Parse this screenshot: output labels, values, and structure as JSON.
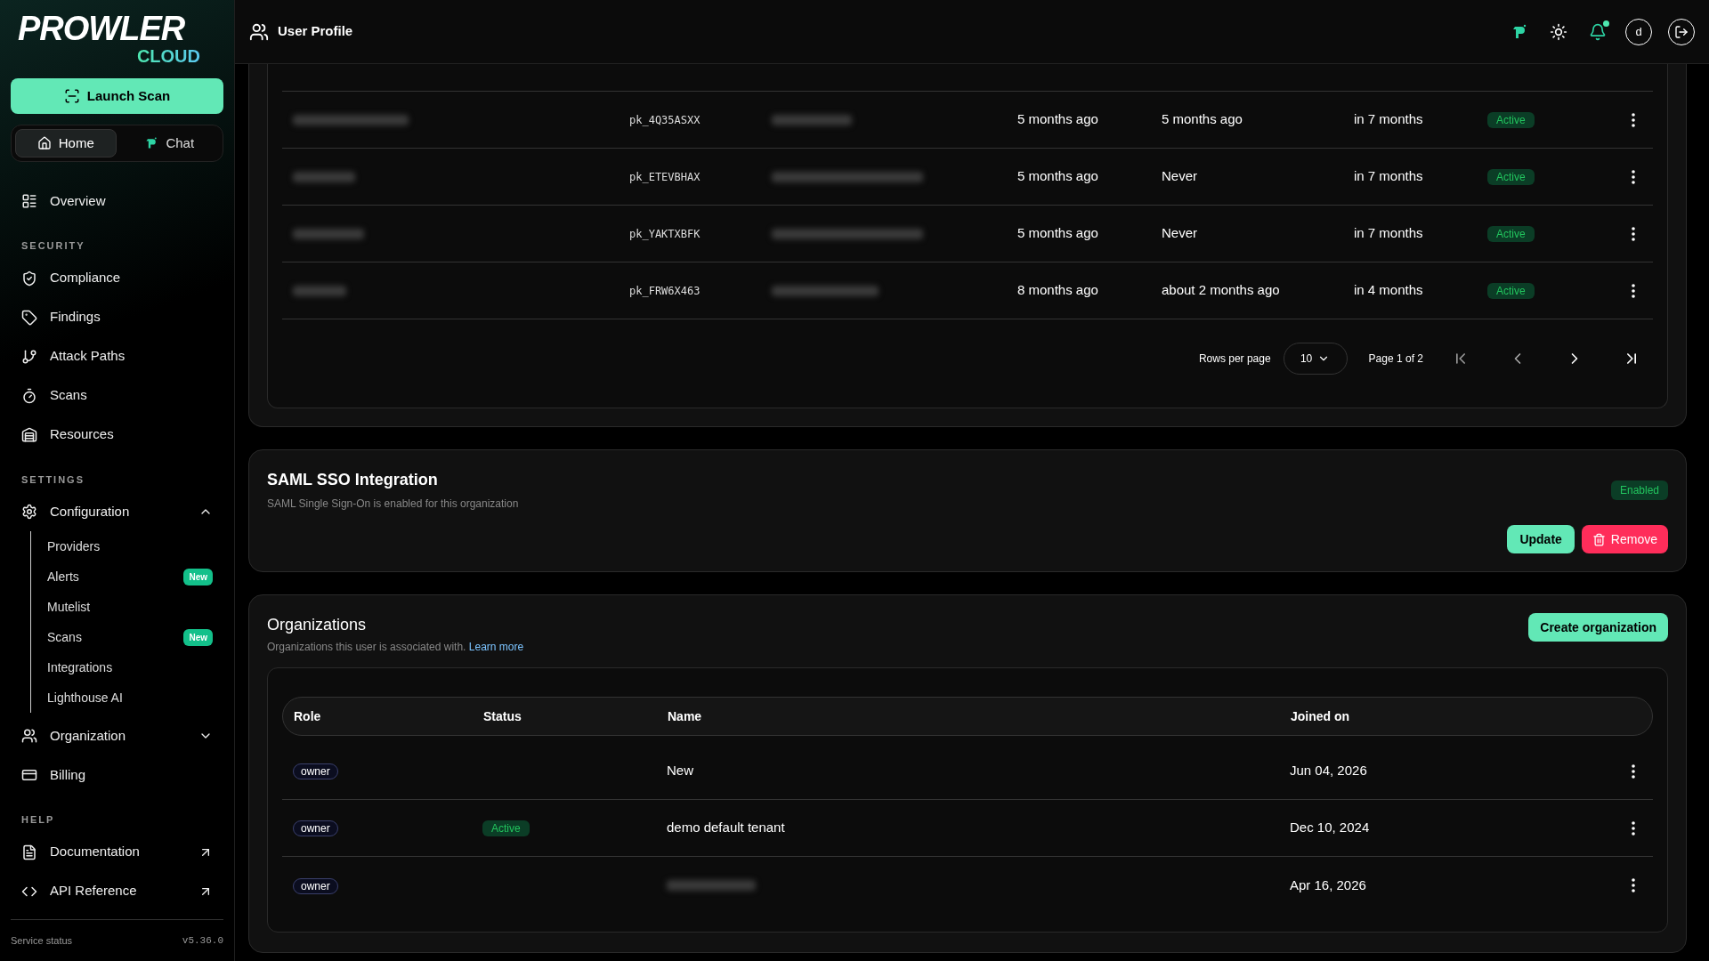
{
  "sidebar": {
    "logo": {
      "word": "PROWLER",
      "sub": "CLOUD"
    },
    "launch_button": "Launch Scan",
    "tabs": [
      {
        "label": "Home",
        "selected": true
      },
      {
        "label": "Chat",
        "selected": false
      }
    ],
    "sections": [
      {
        "items": [
          {
            "label": "Overview"
          }
        ]
      },
      {
        "heading": "SECURITY",
        "items": [
          {
            "label": "Compliance"
          },
          {
            "label": "Findings"
          },
          {
            "label": "Attack Paths"
          },
          {
            "label": "Scans"
          },
          {
            "label": "Resources"
          }
        ]
      },
      {
        "heading": "SETTINGS",
        "items": [
          {
            "label": "Configuration",
            "expanded": true,
            "children": [
              {
                "label": "Providers"
              },
              {
                "label": "Alerts",
                "badge": "New"
              },
              {
                "label": "Mutelist"
              },
              {
                "label": "Scans",
                "badge": "New"
              },
              {
                "label": "Integrations"
              },
              {
                "label": "Lighthouse AI"
              }
            ]
          },
          {
            "label": "Organization",
            "expanded": false
          },
          {
            "label": "Billing"
          }
        ]
      },
      {
        "heading": "HELP",
        "items": [
          {
            "label": "Documentation",
            "external": true
          },
          {
            "label": "API Reference",
            "external": true
          }
        ]
      }
    ],
    "footer": {
      "status": "Service status",
      "version": "v5.36.0"
    }
  },
  "header": {
    "title": "User Profile",
    "avatar": "d",
    "notifications_unread": true
  },
  "api_keys": {
    "rows": [
      {
        "key": "pk_4Q35ASXX",
        "created": "5 months ago",
        "last_used": "5 months ago",
        "expires": "in 7 months",
        "status": "Active"
      },
      {
        "key": "pk_ETEVBHAX",
        "created": "5 months ago",
        "last_used": "Never",
        "expires": "in 7 months",
        "status": "Active"
      },
      {
        "key": "pk_YAKTXBFK",
        "created": "5 months ago",
        "last_used": "Never",
        "expires": "in 7 months",
        "status": "Active"
      },
      {
        "key": "pk_FRW6X463",
        "created": "8 months ago",
        "last_used": "about 2 months ago",
        "expires": "in 4 months",
        "status": "Active"
      }
    ],
    "pagination": {
      "rows_label": "Rows per page",
      "rows_value": "10",
      "page": "Page 1 of 2"
    }
  },
  "saml": {
    "title": "SAML SSO Integration",
    "subtitle": "SAML Single Sign-On is enabled for this organization",
    "badge": "Enabled",
    "update": "Update",
    "remove": "Remove"
  },
  "organizations": {
    "title": "Organizations",
    "subtitle": "Organizations this user is associated with.",
    "link": "Learn more",
    "create": "Create organization",
    "columns": [
      "Role",
      "Status",
      "Name",
      "Joined on"
    ],
    "rows": [
      {
        "role": "owner",
        "name": "New",
        "joined": "Jun 04, 2026"
      },
      {
        "role": "owner",
        "status": "Active",
        "name": "demo default tenant",
        "joined": "Dec 10, 2024"
      },
      {
        "role": "owner",
        "joined": "Apr 16, 2026"
      }
    ]
  }
}
